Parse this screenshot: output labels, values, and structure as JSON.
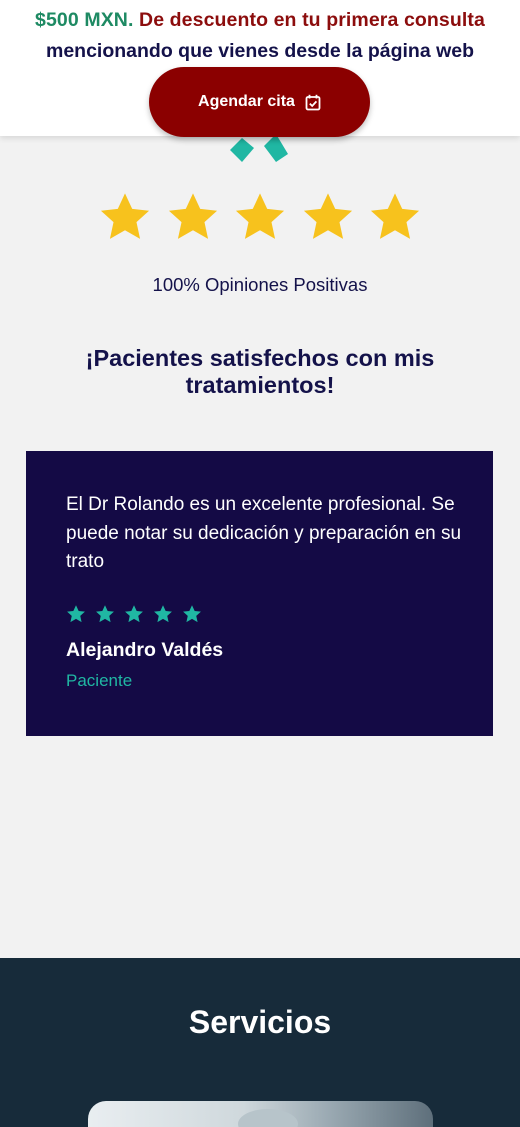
{
  "promo": {
    "price": "$500 MXN.",
    "discount_text": " De descuento en tu primera consulta",
    "line2": "mencionando que vienes desde la página web",
    "cta_label": "Agendar cita",
    "cta_icon": "calendar-check-icon"
  },
  "colors": {
    "price_green": "#1e8a63",
    "discount_red": "#8c0d0d",
    "cta_background": "#8b0000",
    "navy": "#14124a",
    "card_background": "#140a45",
    "teal_accent": "#20b7a3",
    "star_yellow": "#f7c21d",
    "services_background": "#172b3a"
  },
  "rating": {
    "stars_filled": 5,
    "stars_total": 5,
    "caption": "100% Opiniones Positivas"
  },
  "headline": "¡Pacientes satisfechos con mis tratamientos!",
  "testimonial": {
    "quote": "El Dr Rolando es un excelente profesional. Se puede notar su dedicación y preparación en su trato",
    "stars": 5,
    "author": "Alejandro Valdés",
    "role": "Paciente"
  },
  "services": {
    "title": "Servicios"
  }
}
